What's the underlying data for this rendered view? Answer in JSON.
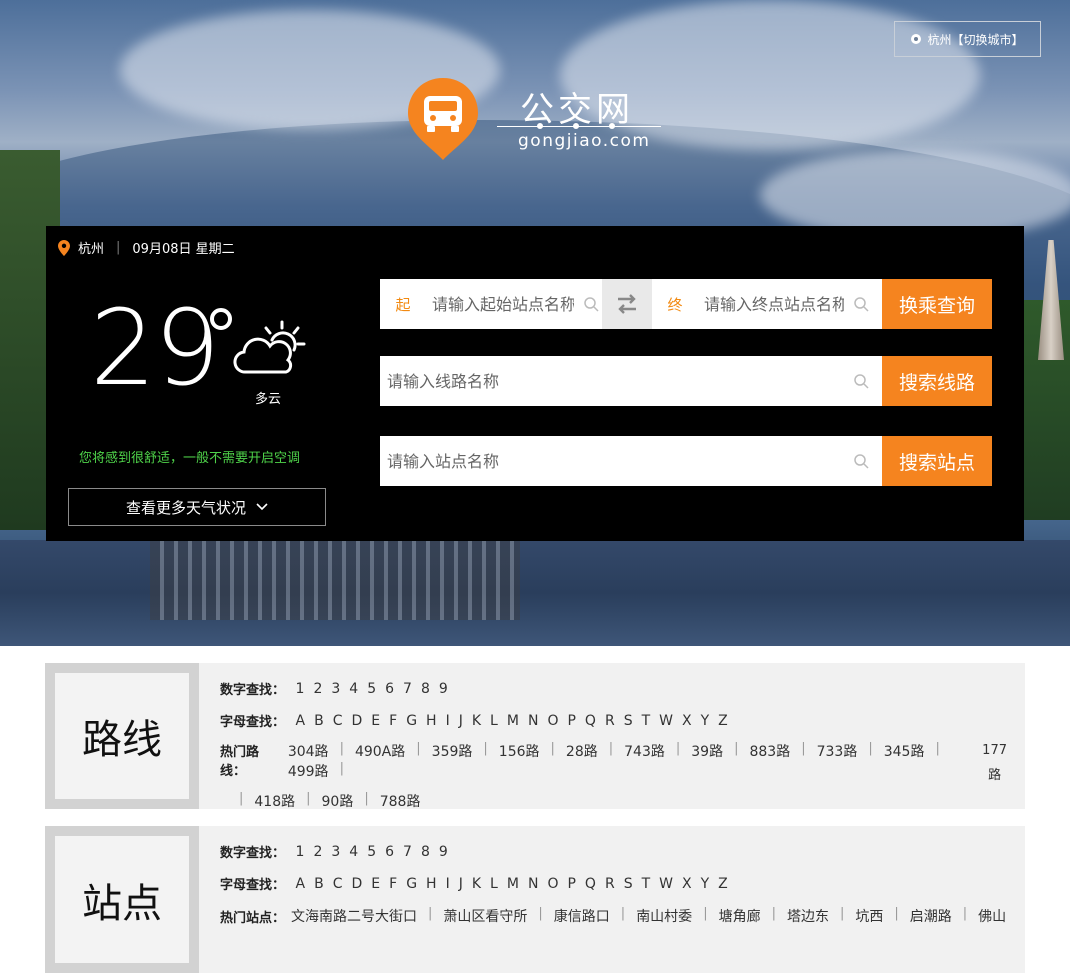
{
  "header": {
    "city_switch": "杭州【切换城市】",
    "logo_title": "公交网",
    "logo_sub": "gongjiao.com"
  },
  "weather": {
    "city": "杭州",
    "date": "09月08日 星期二",
    "temp": "29",
    "desc": "多云",
    "tip": "您将感到很舒适，一般不需要开启空调",
    "more": "查看更多天气状况"
  },
  "search": {
    "start_tag": "起",
    "end_tag": "终",
    "start_placeholder": "请输入起始站点名称",
    "end_placeholder": "请输入终点站点名称",
    "transfer_btn": "换乘查询",
    "line_placeholder": "请输入线路名称",
    "line_btn": "搜索线路",
    "station_placeholder": "请输入站点名称",
    "station_btn": "搜索站点"
  },
  "routes": {
    "title": "路线",
    "num_label": "数字查找：",
    "letter_label": "字母查找：",
    "hot_label": "热门路线：",
    "numbers": [
      "1",
      "2",
      "3",
      "4",
      "5",
      "6",
      "7",
      "8",
      "9"
    ],
    "letters": [
      "A",
      "B",
      "C",
      "D",
      "E",
      "F",
      "G",
      "H",
      "I",
      "J",
      "K",
      "L",
      "M",
      "N",
      "O",
      "P",
      "Q",
      "R",
      "S",
      "T",
      "W",
      "X",
      "Y",
      "Z"
    ],
    "hot_row1": [
      "304路",
      "490A路",
      "359路",
      "156路",
      "28路",
      "743路",
      "39路",
      "883路",
      "733路",
      "345路",
      "499路"
    ],
    "hot_177": "177",
    "hot_177_suffix": "路",
    "hot_row2": [
      "418路",
      "90路",
      "788路"
    ]
  },
  "stations": {
    "title": "站点",
    "num_label": "数字查找：",
    "letter_label": "字母查找：",
    "hot_label": "热门站点：",
    "numbers": [
      "1",
      "2",
      "3",
      "4",
      "5",
      "6",
      "7",
      "8",
      "9"
    ],
    "letters": [
      "A",
      "B",
      "C",
      "D",
      "E",
      "F",
      "G",
      "H",
      "I",
      "J",
      "K",
      "L",
      "M",
      "N",
      "O",
      "P",
      "Q",
      "R",
      "S",
      "T",
      "W",
      "X",
      "Y",
      "Z"
    ],
    "hot": [
      "文海南路二号大街口",
      "萧山区看守所",
      "康信路口",
      "南山村委",
      "塘角廊",
      "塔边东",
      "坑西",
      "启潮路",
      "佛山"
    ]
  },
  "colors": {
    "accent": "#f5841f",
    "tip_green": "#4fd34a"
  }
}
